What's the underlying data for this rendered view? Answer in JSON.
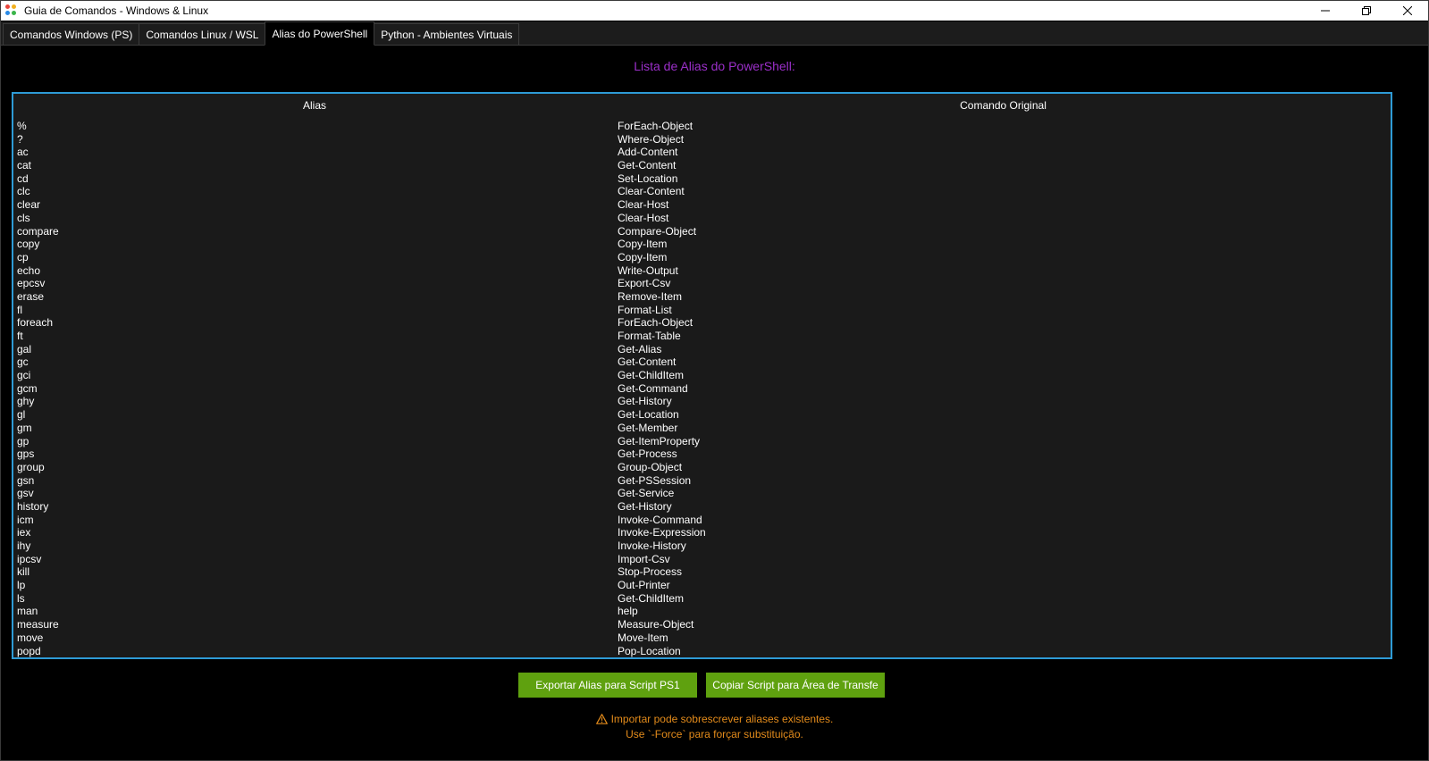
{
  "window": {
    "title": "Guia de Comandos - Windows & Linux",
    "controls": {
      "minimize": "minimize-icon",
      "restore": "restore-icon",
      "close": "close-icon"
    }
  },
  "tabs": [
    {
      "label": "Comandos Windows (PS)",
      "active": false
    },
    {
      "label": "Comandos Linux / WSL",
      "active": false
    },
    {
      "label": "Alias do PowerShell",
      "active": true
    },
    {
      "label": "Python - Ambientes Virtuais",
      "active": false
    }
  ],
  "main": {
    "heading": "Lista de Alias do PowerShell:",
    "table": {
      "columns": [
        "Alias",
        "Comando Original"
      ],
      "rows": [
        [
          "%",
          "ForEach-Object"
        ],
        [
          "?",
          "Where-Object"
        ],
        [
          "ac",
          "Add-Content"
        ],
        [
          "cat",
          "Get-Content"
        ],
        [
          "cd",
          "Set-Location"
        ],
        [
          "clc",
          "Clear-Content"
        ],
        [
          "clear",
          "Clear-Host"
        ],
        [
          "cls",
          "Clear-Host"
        ],
        [
          "compare",
          "Compare-Object"
        ],
        [
          "copy",
          "Copy-Item"
        ],
        [
          "cp",
          "Copy-Item"
        ],
        [
          "echo",
          "Write-Output"
        ],
        [
          "epcsv",
          "Export-Csv"
        ],
        [
          "erase",
          "Remove-Item"
        ],
        [
          "fl",
          "Format-List"
        ],
        [
          "foreach",
          "ForEach-Object"
        ],
        [
          "ft",
          "Format-Table"
        ],
        [
          "gal",
          "Get-Alias"
        ],
        [
          "gc",
          "Get-Content"
        ],
        [
          "gci",
          "Get-ChildItem"
        ],
        [
          "gcm",
          "Get-Command"
        ],
        [
          "ghy",
          "Get-History"
        ],
        [
          "gl",
          "Get-Location"
        ],
        [
          "gm",
          "Get-Member"
        ],
        [
          "gp",
          "Get-ItemProperty"
        ],
        [
          "gps",
          "Get-Process"
        ],
        [
          "group",
          "Group-Object"
        ],
        [
          "gsn",
          "Get-PSSession"
        ],
        [
          "gsv",
          "Get-Service"
        ],
        [
          "history",
          "Get-History"
        ],
        [
          "icm",
          "Invoke-Command"
        ],
        [
          "iex",
          "Invoke-Expression"
        ],
        [
          "ihy",
          "Invoke-History"
        ],
        [
          "ipcsv",
          "Import-Csv"
        ],
        [
          "kill",
          "Stop-Process"
        ],
        [
          "lp",
          "Out-Printer"
        ],
        [
          "ls",
          "Get-ChildItem"
        ],
        [
          "man",
          "help"
        ],
        [
          "measure",
          "Measure-Object"
        ],
        [
          "move",
          "Move-Item"
        ],
        [
          "popd",
          "Pop-Location"
        ]
      ]
    },
    "buttons": {
      "export_label": "Exportar Alias para Script PS1",
      "copy_label": "Copiar Script para Área de Transfe"
    },
    "warning": {
      "icon": "warning-icon",
      "line1": "Importar pode sobrescrever aliases existentes.",
      "line2": "Use `-Force` para forçar substituição."
    }
  },
  "colors": {
    "heading": "#9b2fc9",
    "table_border": "#2e9bd6",
    "button_bg": "#5fa10f",
    "warning": "#e38b1b"
  }
}
